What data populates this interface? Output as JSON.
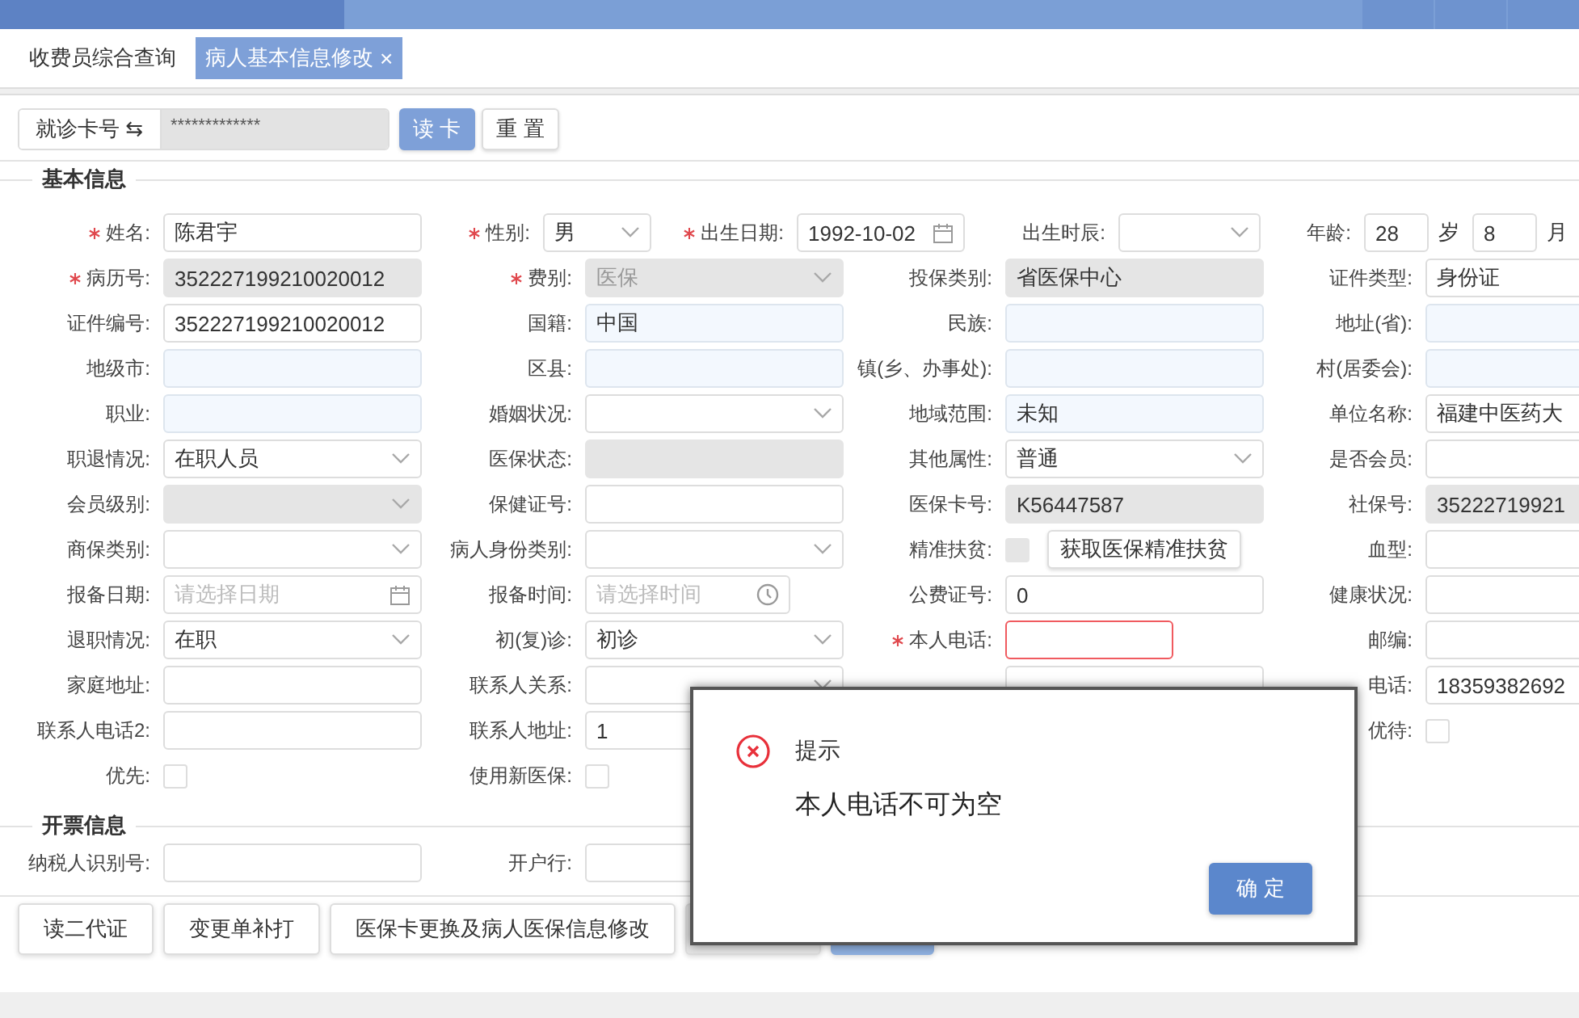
{
  "open_tabs": [
    {
      "label": "收费员综合查询",
      "selected": false,
      "closable": false
    },
    {
      "label": "病人基本信息修改",
      "selected": true,
      "closable": true,
      "close_glyph": "×"
    }
  ],
  "card_reader": {
    "mode_label": "就诊卡号 ⇆",
    "value": "*************",
    "read_button": "读 卡",
    "reset_button": "重 置"
  },
  "sections": [
    {
      "title": "基本信息",
      "top_row": [
        {
          "kind": "text",
          "label": "姓名:",
          "required": true,
          "value": "陈君宇"
        },
        {
          "kind": "select",
          "label": "性别:",
          "required": true,
          "value": "男"
        },
        {
          "kind": "date",
          "label": "出生日期:",
          "required": true,
          "value": "1992-10-02"
        },
        {
          "kind": "select",
          "label": "出生时辰:"
        },
        {
          "kind": "age",
          "label": "年龄:",
          "value": "28",
          "unit": "岁",
          "value2": "8",
          "unit2": "月"
        }
      ],
      "rows": [
        [
          {
            "kind": "text",
            "label": "病历号:",
            "required": true,
            "value": "352227199210020012",
            "readonly": true
          },
          {
            "kind": "select",
            "label": "费别:",
            "required": true,
            "value": "医保",
            "readonly": true,
            "disabled": true
          },
          {
            "kind": "text",
            "label": "投保类别:",
            "value": "省医保中心",
            "readonly": true
          },
          {
            "kind": "text",
            "label": "证件类型:",
            "value": "身份证"
          }
        ],
        [
          {
            "kind": "text",
            "label": "证件编号:",
            "value": "352227199210020012"
          },
          {
            "kind": "text",
            "label": "国籍:",
            "value": "中国",
            "tinted": true
          },
          {
            "kind": "text",
            "label": "民族:",
            "tinted": true
          },
          {
            "kind": "text",
            "label": "地址(省):",
            "tinted": true
          }
        ],
        [
          {
            "kind": "text",
            "label": "地级市:",
            "tinted": true
          },
          {
            "kind": "text",
            "label": "区县:",
            "tinted": true
          },
          {
            "kind": "text",
            "label": "镇(乡、办事处):",
            "tinted": true
          },
          {
            "kind": "text",
            "label": "村(居委会):",
            "tinted": true
          }
        ],
        [
          {
            "kind": "text",
            "label": "职业:",
            "tinted": true
          },
          {
            "kind": "select",
            "label": "婚姻状况:"
          },
          {
            "kind": "text",
            "label": "地域范围:",
            "value": "未知",
            "tinted": true
          },
          {
            "kind": "text",
            "label": "单位名称:",
            "value": "福建中医药大"
          }
        ],
        [
          {
            "kind": "select",
            "label": "职退情况:",
            "value": "在职人员"
          },
          {
            "kind": "text",
            "label": "医保状态:",
            "readonly": true
          },
          {
            "kind": "select",
            "label": "其他属性:",
            "value": "普通"
          },
          {
            "kind": "text",
            "label": "是否会员:"
          }
        ],
        [
          {
            "kind": "select",
            "label": "会员级别:",
            "readonly": true
          },
          {
            "kind": "text",
            "label": "保健证号:"
          },
          {
            "kind": "text",
            "label": "医保卡号:",
            "value": "K56447587",
            "readonly": true
          },
          {
            "kind": "text",
            "label": "社保号:",
            "value": "35222719921",
            "readonly": true
          }
        ],
        [
          {
            "kind": "select",
            "label": "商保类别:"
          },
          {
            "kind": "select",
            "label": "病人身份类别:"
          },
          {
            "kind": "check_button",
            "label": "精准扶贫:",
            "checked": false,
            "disabled": true,
            "button": "获取医保精准扶贫"
          },
          {
            "kind": "text",
            "label": "血型:"
          }
        ],
        [
          {
            "kind": "date",
            "label": "报备日期:",
            "placeholder": "请选择日期"
          },
          {
            "kind": "time",
            "label": "报备时间:",
            "placeholder": "请选择时间"
          },
          {
            "kind": "text",
            "label": "公费证号:",
            "value": "0"
          },
          {
            "kind": "text",
            "label": "健康状况:"
          }
        ],
        [
          {
            "kind": "select",
            "label": "退职情况:",
            "value": "在职"
          },
          {
            "kind": "select",
            "label": "初(复)诊:",
            "value": "初诊"
          },
          {
            "kind": "phone",
            "label": "本人电话:",
            "required": true,
            "invalid": true
          },
          {
            "kind": "text",
            "label": "邮编:"
          }
        ],
        [
          {
            "kind": "text",
            "label": "家庭地址:"
          },
          {
            "kind": "select",
            "label": "联系人关系:"
          },
          {
            "kind": "text"
          },
          {
            "kind": "text",
            "label": "电话:",
            "value": "18359382692"
          }
        ],
        [
          {
            "kind": "text",
            "label": "联系人电话2:"
          },
          {
            "kind": "text",
            "label": "联系人地址:",
            "value": "1"
          },
          {
            "kind": "blank"
          },
          {
            "kind": "check",
            "label": "优待:",
            "checked": false
          }
        ],
        [
          {
            "kind": "check",
            "label": "优先:",
            "checked": false
          },
          {
            "kind": "check",
            "label": "使用新医保:",
            "checked": false
          }
        ]
      ]
    },
    {
      "title": "开票信息",
      "rows": [
        [
          {
            "kind": "text",
            "label": "纳税人识别号:"
          },
          {
            "kind": "text",
            "label": "开户行:"
          }
        ]
      ]
    }
  ],
  "actions": [
    {
      "label": "读二代证",
      "kind": "plain"
    },
    {
      "label": "变更单补打",
      "kind": "plain"
    },
    {
      "label": "医保卡更换及病人医保信息修改",
      "kind": "plain"
    },
    {
      "kind": "grey"
    },
    {
      "kind": "primary_disabled"
    }
  ],
  "dialog": {
    "title": "提示",
    "message": "本人电话不可为空",
    "ok_button": "确 定"
  }
}
